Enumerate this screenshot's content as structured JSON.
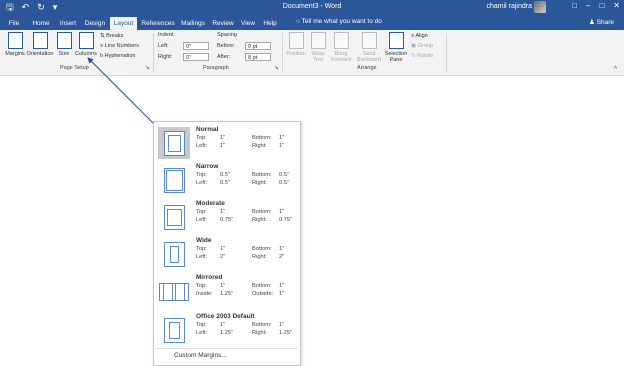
{
  "titlebar": {
    "title": "Document3 - Word",
    "user": "chamil rajindra",
    "save_icon": "save-icon",
    "undo_icon": "undo-icon",
    "redo_icon": "redo-icon"
  },
  "tabs": [
    "File",
    "Home",
    "Insert",
    "Design",
    "Layout",
    "References",
    "Mailings",
    "Review",
    "View",
    "Help"
  ],
  "active_tab": "Layout",
  "tell_me": "Tell me what you want to do",
  "share": "Share",
  "ribbon": {
    "page_setup": {
      "label": "Page Setup",
      "margins": "Margins",
      "orientation": "Orientation",
      "size": "Size",
      "columns": "Columns",
      "breaks": "Breaks",
      "line_numbers": "Line Numbers",
      "hyphenation": "Hyphenation"
    },
    "paragraph": {
      "label": "Paragraph",
      "indent": "Indent",
      "spacing": "Spacing",
      "left": "Left:",
      "right": "Right:",
      "before": "Before:",
      "after": "After:",
      "left_val": "0\"",
      "right_val": "0\"",
      "before_val": "0 pt",
      "after_val": "8 pt"
    },
    "arrange": {
      "label": "Arrange",
      "position": "Position",
      "wrap_text": "Wrap Text",
      "bring_forward": "Bring Forward",
      "send_backward": "Send Backward",
      "selection_pane": "Selection Pane",
      "align": "Align",
      "group": "Group",
      "rotate": "Rotate"
    }
  },
  "margins_menu": {
    "options": [
      {
        "name": "Normal",
        "r1a": "Top:",
        "r1b": "1\"",
        "r1c": "Bottom:",
        "r1d": "1\"",
        "r2a": "Left:",
        "r2b": "1\"",
        "r2c": "Right:",
        "r2d": "1\""
      },
      {
        "name": "Narrow",
        "r1a": "Top:",
        "r1b": "0.5\"",
        "r1c": "Bottom:",
        "r1d": "0.5\"",
        "r2a": "Left:",
        "r2b": "0.5\"",
        "r2c": "Right:",
        "r2d": "0.5\""
      },
      {
        "name": "Moderate",
        "r1a": "Top:",
        "r1b": "1\"",
        "r1c": "Bottom:",
        "r1d": "1\"",
        "r2a": "Left:",
        "r2b": "0.75\"",
        "r2c": "Right:",
        "r2d": "0.75\""
      },
      {
        "name": "Wide",
        "r1a": "Top:",
        "r1b": "1\"",
        "r1c": "Bottom:",
        "r1d": "1\"",
        "r2a": "Left:",
        "r2b": "2\"",
        "r2c": "Right:",
        "r2d": "2\""
      },
      {
        "name": "Mirrored",
        "r1a": "Top:",
        "r1b": "1\"",
        "r1c": "Bottom:",
        "r1d": "1\"",
        "r2a": "Inside:",
        "r2b": "1.25\"",
        "r2c": "Outside:",
        "r2d": "1\""
      },
      {
        "name": "Office 2003 Default",
        "r1a": "Top:",
        "r1b": "1\"",
        "r1c": "Bottom:",
        "r1d": "1\"",
        "r2a": "Left:",
        "r2b": "1.25\"",
        "r2c": "Right:",
        "r2d": "1.25\""
      }
    ],
    "custom": "Custom Margins..."
  },
  "colors": {
    "accent": "#2b579a",
    "selected": "#c8c8c8",
    "arrow": "#2f4f9e"
  }
}
